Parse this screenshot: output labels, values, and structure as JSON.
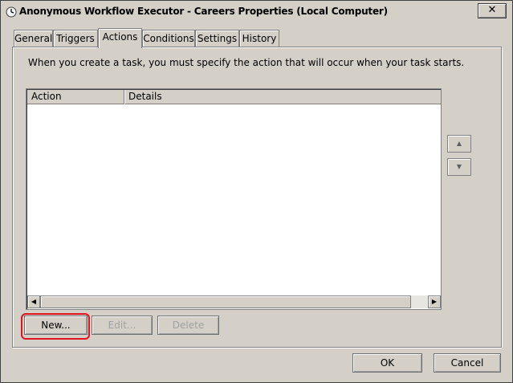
{
  "window": {
    "title": "Anonymous Workflow Executor - Careers Properties (Local Computer)",
    "close_glyph": "✕"
  },
  "tabs": [
    {
      "label": "General",
      "active": false
    },
    {
      "label": "Triggers",
      "active": false
    },
    {
      "label": "Actions",
      "active": true
    },
    {
      "label": "Conditions",
      "active": false
    },
    {
      "label": "Settings",
      "active": false
    },
    {
      "label": "History",
      "active": false
    }
  ],
  "actions_panel": {
    "intro": "When you create a task, you must specify the action that will occur when your task starts.",
    "columns": [
      "Action",
      "Details"
    ],
    "rows": [],
    "move_up_glyph": "▲",
    "move_down_glyph": "▼",
    "scroll_left_glyph": "◀",
    "scroll_right_glyph": "▶",
    "new_button": "New...",
    "edit_button": "Edit...",
    "delete_button": "Delete"
  },
  "footer": {
    "ok_button": "OK",
    "cancel_button": "Cancel"
  },
  "colors": {
    "highlight": "#e0141e",
    "face": "#d4d0c8"
  }
}
